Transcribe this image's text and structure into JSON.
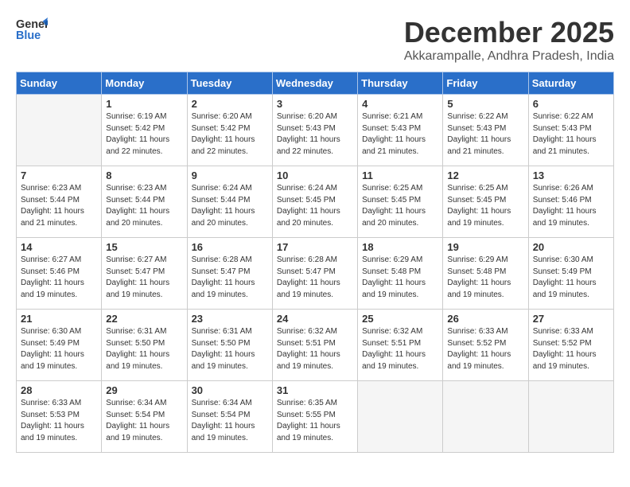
{
  "header": {
    "logo_line1": "General",
    "logo_line2": "Blue",
    "month": "December 2025",
    "location": "Akkarampalle, Andhra Pradesh, India"
  },
  "weekdays": [
    "Sunday",
    "Monday",
    "Tuesday",
    "Wednesday",
    "Thursday",
    "Friday",
    "Saturday"
  ],
  "weeks": [
    [
      {
        "day": "",
        "info": ""
      },
      {
        "day": "1",
        "info": "Sunrise: 6:19 AM\nSunset: 5:42 PM\nDaylight: 11 hours\nand 22 minutes."
      },
      {
        "day": "2",
        "info": "Sunrise: 6:20 AM\nSunset: 5:42 PM\nDaylight: 11 hours\nand 22 minutes."
      },
      {
        "day": "3",
        "info": "Sunrise: 6:20 AM\nSunset: 5:43 PM\nDaylight: 11 hours\nand 22 minutes."
      },
      {
        "day": "4",
        "info": "Sunrise: 6:21 AM\nSunset: 5:43 PM\nDaylight: 11 hours\nand 21 minutes."
      },
      {
        "day": "5",
        "info": "Sunrise: 6:22 AM\nSunset: 5:43 PM\nDaylight: 11 hours\nand 21 minutes."
      },
      {
        "day": "6",
        "info": "Sunrise: 6:22 AM\nSunset: 5:43 PM\nDaylight: 11 hours\nand 21 minutes."
      }
    ],
    [
      {
        "day": "7",
        "info": "Sunrise: 6:23 AM\nSunset: 5:44 PM\nDaylight: 11 hours\nand 21 minutes."
      },
      {
        "day": "8",
        "info": "Sunrise: 6:23 AM\nSunset: 5:44 PM\nDaylight: 11 hours\nand 20 minutes."
      },
      {
        "day": "9",
        "info": "Sunrise: 6:24 AM\nSunset: 5:44 PM\nDaylight: 11 hours\nand 20 minutes."
      },
      {
        "day": "10",
        "info": "Sunrise: 6:24 AM\nSunset: 5:45 PM\nDaylight: 11 hours\nand 20 minutes."
      },
      {
        "day": "11",
        "info": "Sunrise: 6:25 AM\nSunset: 5:45 PM\nDaylight: 11 hours\nand 20 minutes."
      },
      {
        "day": "12",
        "info": "Sunrise: 6:25 AM\nSunset: 5:45 PM\nDaylight: 11 hours\nand 19 minutes."
      },
      {
        "day": "13",
        "info": "Sunrise: 6:26 AM\nSunset: 5:46 PM\nDaylight: 11 hours\nand 19 minutes."
      }
    ],
    [
      {
        "day": "14",
        "info": "Sunrise: 6:27 AM\nSunset: 5:46 PM\nDaylight: 11 hours\nand 19 minutes."
      },
      {
        "day": "15",
        "info": "Sunrise: 6:27 AM\nSunset: 5:47 PM\nDaylight: 11 hours\nand 19 minutes."
      },
      {
        "day": "16",
        "info": "Sunrise: 6:28 AM\nSunset: 5:47 PM\nDaylight: 11 hours\nand 19 minutes."
      },
      {
        "day": "17",
        "info": "Sunrise: 6:28 AM\nSunset: 5:47 PM\nDaylight: 11 hours\nand 19 minutes."
      },
      {
        "day": "18",
        "info": "Sunrise: 6:29 AM\nSunset: 5:48 PM\nDaylight: 11 hours\nand 19 minutes."
      },
      {
        "day": "19",
        "info": "Sunrise: 6:29 AM\nSunset: 5:48 PM\nDaylight: 11 hours\nand 19 minutes."
      },
      {
        "day": "20",
        "info": "Sunrise: 6:30 AM\nSunset: 5:49 PM\nDaylight: 11 hours\nand 19 minutes."
      }
    ],
    [
      {
        "day": "21",
        "info": "Sunrise: 6:30 AM\nSunset: 5:49 PM\nDaylight: 11 hours\nand 19 minutes."
      },
      {
        "day": "22",
        "info": "Sunrise: 6:31 AM\nSunset: 5:50 PM\nDaylight: 11 hours\nand 19 minutes."
      },
      {
        "day": "23",
        "info": "Sunrise: 6:31 AM\nSunset: 5:50 PM\nDaylight: 11 hours\nand 19 minutes."
      },
      {
        "day": "24",
        "info": "Sunrise: 6:32 AM\nSunset: 5:51 PM\nDaylight: 11 hours\nand 19 minutes."
      },
      {
        "day": "25",
        "info": "Sunrise: 6:32 AM\nSunset: 5:51 PM\nDaylight: 11 hours\nand 19 minutes."
      },
      {
        "day": "26",
        "info": "Sunrise: 6:33 AM\nSunset: 5:52 PM\nDaylight: 11 hours\nand 19 minutes."
      },
      {
        "day": "27",
        "info": "Sunrise: 6:33 AM\nSunset: 5:52 PM\nDaylight: 11 hours\nand 19 minutes."
      }
    ],
    [
      {
        "day": "28",
        "info": "Sunrise: 6:33 AM\nSunset: 5:53 PM\nDaylight: 11 hours\nand 19 minutes."
      },
      {
        "day": "29",
        "info": "Sunrise: 6:34 AM\nSunset: 5:54 PM\nDaylight: 11 hours\nand 19 minutes."
      },
      {
        "day": "30",
        "info": "Sunrise: 6:34 AM\nSunset: 5:54 PM\nDaylight: 11 hours\nand 19 minutes."
      },
      {
        "day": "31",
        "info": "Sunrise: 6:35 AM\nSunset: 5:55 PM\nDaylight: 11 hours\nand 19 minutes."
      },
      {
        "day": "",
        "info": ""
      },
      {
        "day": "",
        "info": ""
      },
      {
        "day": "",
        "info": ""
      }
    ]
  ]
}
